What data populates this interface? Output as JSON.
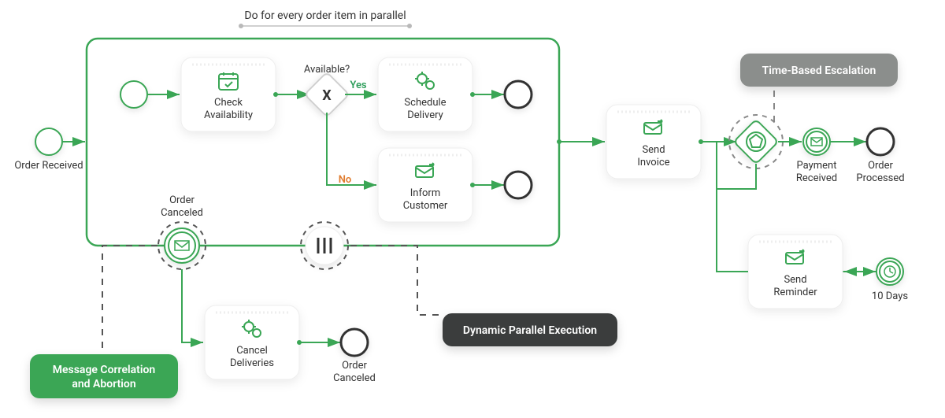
{
  "subprocess": {
    "title": "Do for every order item in parallel"
  },
  "events": {
    "orderReceived": "Order\nReceived",
    "orderCanceledBoundary": "Order\nCanceled",
    "orderCanceledEnd": "Order\nCanceled",
    "paymentReceived": "Payment\nReceived",
    "orderProcessed": "Order\nProcessed",
    "tenDays": "10 Days"
  },
  "tasks": {
    "checkAvailability": "Check\nAvailability",
    "scheduleDelivery": "Schedule\nDelivery",
    "informCustomer": "Inform\nCustomer",
    "sendInvoice": "Send\nInvoice",
    "sendReminder": "Send\nReminder",
    "cancelDeliveries": "Cancel\nDeliveries"
  },
  "gateway": {
    "available": "Available?",
    "yes": "Yes",
    "no": "No"
  },
  "callouts": {
    "messageCorrelation": "Message Correlation\nand Abortion",
    "dynamicParallel": "Dynamic Parallel Execution",
    "timeEscalation": "Time-Based Escalation"
  },
  "colors": {
    "green": "#3aa655",
    "greenFill": "#ffffff",
    "greyBadge": "#8b8e8c",
    "darkBadge": "#3a3d3c",
    "greenBadge": "#3aa655",
    "taskStroke": "#d9d9d9",
    "subOutline": "#3aa655"
  }
}
